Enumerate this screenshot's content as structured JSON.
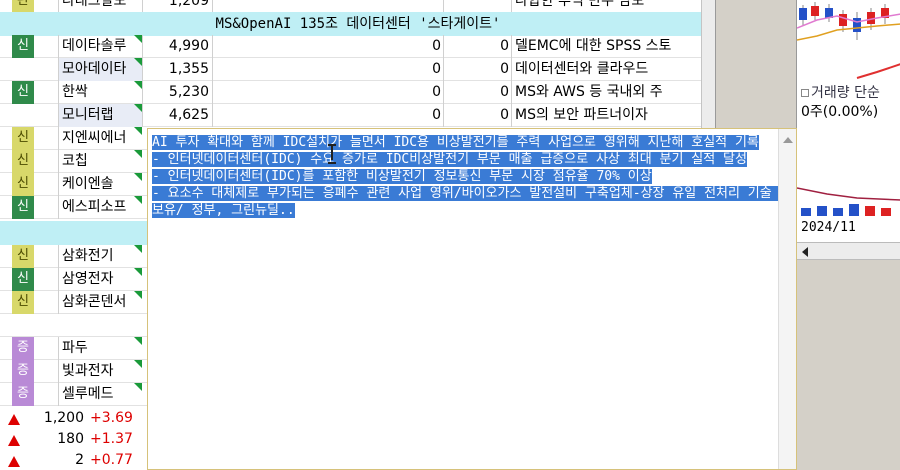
{
  "grid": {
    "top_partial": {
      "badge": "관",
      "name": "나래크알모",
      "price": "1,209",
      "v1": "",
      "v2": "",
      "note": "나합한 부익 만우 남보"
    },
    "section1_header": "MS&OpenAI 135조 데이터센터 '스타게이트'",
    "rows1": [
      {
        "badge": "신",
        "name": "데이타솔루",
        "price": "4,990",
        "v1": "0",
        "v2": "0",
        "note": "델EMC에 대한 SPSS 스토"
      },
      {
        "badge": "",
        "name": "모아데이타",
        "price": "1,355",
        "v1": "0",
        "v2": "0",
        "note": "데이터센터와 클라우드"
      },
      {
        "badge": "신",
        "name": "한싹",
        "price": "5,230",
        "v1": "0",
        "v2": "0",
        "note": "MS와 AWS 등 국내외 주"
      },
      {
        "badge": "",
        "name": "모니터랩",
        "price": "4,625",
        "v1": "0",
        "v2": "0",
        "note": "MS의 보안 파트너이자"
      }
    ],
    "rows2": [
      {
        "badge": "신",
        "name": "지엔씨에너"
      },
      {
        "badge": "신",
        "name": "코칩"
      },
      {
        "badge": "신",
        "name": "케이엔솔"
      },
      {
        "badge": "신",
        "name": "에스피소프"
      }
    ],
    "rows3": [
      {
        "badge": "신",
        "name": "삼화전기"
      },
      {
        "badge": "신",
        "name": "삼영전자"
      },
      {
        "badge": "신",
        "name": "삼화콘덴서"
      }
    ],
    "rows4": [
      {
        "badge": "증",
        "name": "파두"
      },
      {
        "badge": "증",
        "name": "빛과전자"
      },
      {
        "badge": "증",
        "name": "셀루메드"
      }
    ]
  },
  "bottom_rows": [
    {
      "price": "1,200",
      "change": "+3.69"
    },
    {
      "price": "180",
      "change": "+1.37"
    },
    {
      "price": "2",
      "change": "+0.77"
    }
  ],
  "right_panel": {
    "volume_label": "거래량 단순",
    "volume_value": "0주(0.00%)",
    "date_label": "2024/11"
  },
  "memo": {
    "text": "AI 투자 확대와 함께 IDC설치가 늘면서 IDC용 비상발전기를 주력 사업으로 영위해 지난해 호실적 기록\n- 인터넷데이터센터(IDC) 수요 증가로 IDC비상발전기 부문 매출 급증으로 사상 최대 분기 실적 달성\n- 인터넷데이터센터(IDC)를 포함한 비상발전기 정보통신 부문 시장 점유율 70% 이상\n- 요소수 대체제로 부가되는 응폐수 관련 사업 영위/바이오가스 발전설비 구축업체-상장 유일 전처리 기술 보유/ 정부, 그린뉴딜.."
  },
  "colors": {
    "section_header_bg": "#bfeff5",
    "badge_green": "#2f8a4a",
    "badge_yellow": "#d8d86a",
    "badge_purple": "#b98ad6",
    "selection_bg": "#3a7bd5",
    "up_red": "#dd0000"
  },
  "chart_data": {
    "type": "candlestick",
    "title": "",
    "xlabel": "",
    "ylabel": "",
    "series": []
  }
}
